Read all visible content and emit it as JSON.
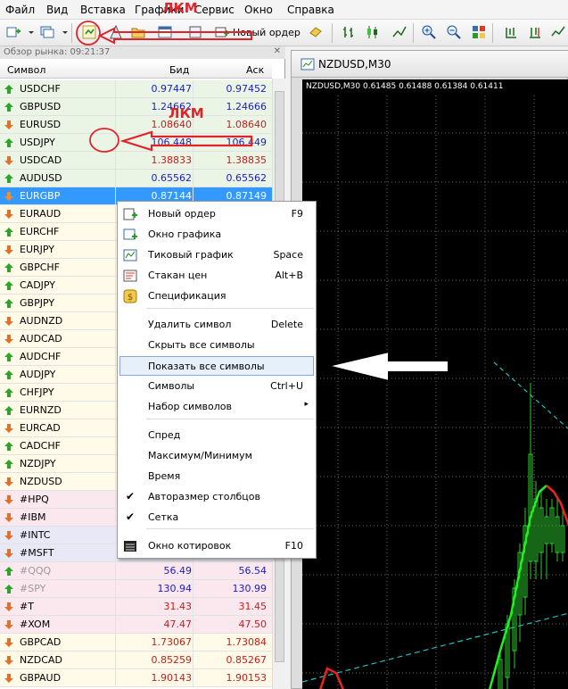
{
  "menu": [
    "Файл",
    "Вид",
    "Вставка",
    "Графики",
    "Сервис",
    "Окно",
    "Справка"
  ],
  "toolbar": {
    "new_order_label": "Новый ордер"
  },
  "market_watch": {
    "title": "Обзор рынка: 09:21:37",
    "columns": {
      "symbol": "Символ",
      "bid": "Бид",
      "ask": "Аск"
    },
    "rows": [
      {
        "symbol": "USDCHF",
        "bid": "0.97447",
        "ask": "0.97452",
        "dir": "up",
        "color": "#1a1acc",
        "bg": "#eaf5e6"
      },
      {
        "symbol": "GBPUSD",
        "bid": "1.24662",
        "ask": "1.24666",
        "dir": "up",
        "color": "#1a1acc",
        "bg": "#eaf5e6"
      },
      {
        "symbol": "EURUSD",
        "bid": "1.08640",
        "ask": "1.08640",
        "dir": "down",
        "color": "#cc1a1a",
        "bg": "#eaf5e6"
      },
      {
        "symbol": "USDJPY",
        "bid": "106.448",
        "ask": "106.449",
        "dir": "up",
        "color": "#1a1acc",
        "bg": "#eaf5e6"
      },
      {
        "symbol": "USDCAD",
        "bid": "1.38833",
        "ask": "1.38835",
        "dir": "down",
        "color": "#cc1a1a",
        "bg": "#eaf5e6"
      },
      {
        "symbol": "AUDUSD",
        "bid": "0.65562",
        "ask": "0.65562",
        "dir": "up",
        "color": "#1a1acc",
        "bg": "#eaf5e6"
      },
      {
        "symbol": "EURGBP",
        "bid": "0.87144",
        "ask": "0.87149",
        "dir": "down",
        "color": "#ffffff",
        "bg": "#3399ff",
        "selected": true
      },
      {
        "symbol": "EURAUD",
        "bid": "",
        "ask": "",
        "dir": "down",
        "color": "#000",
        "bg": "#fffbe8"
      },
      {
        "symbol": "EURCHF",
        "bid": "",
        "ask": "",
        "dir": "up",
        "color": "#000",
        "bg": "#fffbe8"
      },
      {
        "symbol": "EURJPY",
        "bid": "",
        "ask": "",
        "dir": "down",
        "color": "#000",
        "bg": "#fffbe8"
      },
      {
        "symbol": "GBPCHF",
        "bid": "",
        "ask": "",
        "dir": "up",
        "color": "#000",
        "bg": "#fffbe8"
      },
      {
        "symbol": "CADJPY",
        "bid": "",
        "ask": "",
        "dir": "up",
        "color": "#000",
        "bg": "#fffbe8"
      },
      {
        "symbol": "GBPJPY",
        "bid": "",
        "ask": "",
        "dir": "up",
        "color": "#000",
        "bg": "#fffbe8"
      },
      {
        "symbol": "AUDNZD",
        "bid": "",
        "ask": "",
        "dir": "down",
        "color": "#000",
        "bg": "#fffbe8"
      },
      {
        "symbol": "AUDCAD",
        "bid": "",
        "ask": "",
        "dir": "down",
        "color": "#000",
        "bg": "#fffbe8"
      },
      {
        "symbol": "AUDCHF",
        "bid": "",
        "ask": "",
        "dir": "up",
        "color": "#000",
        "bg": "#fffbe8"
      },
      {
        "symbol": "AUDJPY",
        "bid": "",
        "ask": "",
        "dir": "up",
        "color": "#000",
        "bg": "#fffbe8"
      },
      {
        "symbol": "CHFJPY",
        "bid": "",
        "ask": "",
        "dir": "up",
        "color": "#000",
        "bg": "#fffbe8"
      },
      {
        "symbol": "EURNZD",
        "bid": "",
        "ask": "",
        "dir": "up",
        "color": "#000",
        "bg": "#fffbe8"
      },
      {
        "symbol": "EURCAD",
        "bid": "",
        "ask": "",
        "dir": "down",
        "color": "#000",
        "bg": "#fffbe8"
      },
      {
        "symbol": "CADCHF",
        "bid": "",
        "ask": "",
        "dir": "up",
        "color": "#000",
        "bg": "#fffbe8"
      },
      {
        "symbol": "NZDJPY",
        "bid": "",
        "ask": "",
        "dir": "up",
        "color": "#000",
        "bg": "#fffbe8"
      },
      {
        "symbol": "NZDUSD",
        "bid": "",
        "ask": "",
        "dir": "down",
        "color": "#000",
        "bg": "#fffbe8"
      },
      {
        "symbol": "#HPQ",
        "bid": "",
        "ask": "",
        "dir": "down",
        "color": "#000",
        "bg": "#fbe8ee"
      },
      {
        "symbol": "#IBM",
        "bid": "",
        "ask": "",
        "dir": "down",
        "color": "#000",
        "bg": "#fbe8ee"
      },
      {
        "symbol": "#INTC",
        "bid": "",
        "ask": "",
        "dir": "down",
        "color": "#000",
        "bg": "#e8e8f6"
      },
      {
        "symbol": "#MSFT",
        "bid": "",
        "ask": "",
        "dir": "down",
        "color": "#000",
        "bg": "#e8e8f6"
      },
      {
        "symbol": "#QQQ",
        "bid": "56.49",
        "ask": "56.54",
        "dir": "up",
        "color": "#1a1acc",
        "bg": "#fbe8ee",
        "muted": true
      },
      {
        "symbol": "#SPY",
        "bid": "130.94",
        "ask": "130.99",
        "dir": "up",
        "color": "#1a1acc",
        "bg": "#fbe8ee",
        "muted": true
      },
      {
        "symbol": "#T",
        "bid": "31.43",
        "ask": "31.45",
        "dir": "down",
        "color": "#cc1a1a",
        "bg": "#fbe8ee"
      },
      {
        "symbol": "#XOM",
        "bid": "47.47",
        "ask": "47.50",
        "dir": "down",
        "color": "#cc1a1a",
        "bg": "#fbe8ee"
      },
      {
        "symbol": "GBPCAD",
        "bid": "1.73067",
        "ask": "1.73084",
        "dir": "down",
        "color": "#cc1a1a",
        "bg": "#fffbe8"
      },
      {
        "symbol": "NZDCAD",
        "bid": "0.85259",
        "ask": "0.85267",
        "dir": "down",
        "color": "#cc1a1a",
        "bg": "#fffbe8"
      },
      {
        "symbol": "GBPAUD",
        "bid": "1.90143",
        "ask": "1.90153",
        "dir": "down",
        "color": "#cc1a1a",
        "bg": "#fffbe8"
      }
    ]
  },
  "chart": {
    "window_title": "NZDUSD,M30",
    "info_line": "NZDUSD,M30  0.61485 0.61488 0.61384 0.61411"
  },
  "context_menu": {
    "items": [
      {
        "label": "Новый ордер",
        "shortcut": "F9",
        "icon": "new-order-icon"
      },
      {
        "label": "Окно графика",
        "shortcut": "",
        "icon": "chart-window-icon"
      },
      {
        "label": "Тиковый график",
        "shortcut": "Space",
        "icon": "tick-chart-icon"
      },
      {
        "label": "Стакан цен",
        "shortcut": "Alt+B",
        "icon": "depth-of-market-icon"
      },
      {
        "label": "Спецификация",
        "shortcut": "",
        "icon": "specification-icon"
      },
      {
        "label": "Удалить символ",
        "shortcut": "Delete"
      },
      {
        "label": "Скрыть все символы",
        "shortcut": ""
      },
      {
        "label": "Показать все символы",
        "shortcut": "",
        "highlighted": true
      },
      {
        "label": "Символы",
        "shortcut": "Ctrl+U"
      },
      {
        "label": "Набор символов",
        "shortcut": "",
        "submenu": true
      },
      {
        "label": "Спред",
        "shortcut": ""
      },
      {
        "label": "Максимум/Минимум",
        "shortcut": ""
      },
      {
        "label": "Время",
        "shortcut": ""
      },
      {
        "label": "Авторазмер столбцов",
        "shortcut": "",
        "checked": true
      },
      {
        "label": "Сетка",
        "shortcut": "",
        "checked": true
      },
      {
        "label": "Окно котировок",
        "shortcut": "F10",
        "icon": "quotes-window-icon"
      }
    ]
  },
  "annotations": {
    "top_label": "ЛКМ",
    "left_label": "ЛКМ",
    "right_label": "ЛКМ",
    "red_color": "#e0242c"
  }
}
